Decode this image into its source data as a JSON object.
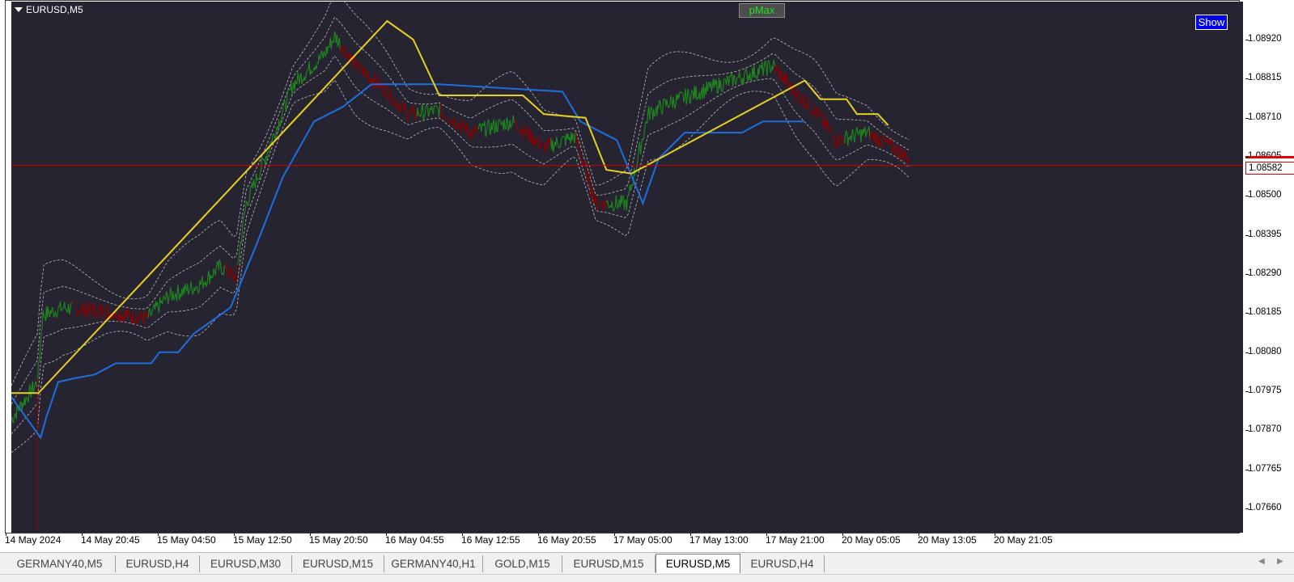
{
  "chart": {
    "symbol": "EURUSD,M5",
    "indicator_label": "pMax",
    "show_button": "Show",
    "current_price": "1.08582",
    "price_ticks": [
      "1.08920",
      "1.08815",
      "1.08710",
      "1.08605",
      "1.08500",
      "1.08395",
      "1.08290",
      "1.08185",
      "1.08080",
      "1.07975",
      "1.07870",
      "1.07765",
      "1.07660"
    ],
    "time_ticks": [
      "14 May 2024",
      "14 May 20:45",
      "15 May 04:50",
      "15 May 12:50",
      "15 May 20:50",
      "16 May 04:55",
      "16 May 12:55",
      "16 May 20:55",
      "17 May 05:00",
      "17 May 13:00",
      "17 May 21:00",
      "20 May 05:05",
      "20 May 13:05",
      "20 May 21:05"
    ],
    "colors": {
      "background": "#272431",
      "up_candle": "#1e8a1e",
      "down_candle": "#8b0000",
      "support_line": "#1e6ee0",
      "resistance_line": "#e6d21e",
      "bands": "#d8d8d8",
      "price_line": "#d00000"
    }
  },
  "chart_data": {
    "type": "line",
    "title": "EURUSD,M5",
    "ylim": [
      1.0762,
      1.0899
    ],
    "x_start": "14 May 2024",
    "x_end": "20 May 21:05",
    "current_price": 1.08582,
    "series": [
      {
        "name": "pMax",
        "color": "#1e6ee0",
        "points": [
          [
            0.0,
            1.0796
          ],
          [
            0.028,
            1.0785
          ],
          [
            0.034,
            1.0791
          ],
          [
            0.045,
            1.08
          ],
          [
            0.061,
            1.0801
          ],
          [
            0.08,
            1.0802
          ],
          [
            0.1,
            1.0805
          ],
          [
            0.134,
            1.0805
          ],
          [
            0.142,
            1.0808
          ],
          [
            0.16,
            1.0808
          ],
          [
            0.175,
            1.0813
          ],
          [
            0.21,
            1.082
          ],
          [
            0.235,
            1.0837
          ],
          [
            0.26,
            1.0855
          ],
          [
            0.29,
            1.087
          ],
          [
            0.318,
            1.0874
          ],
          [
            0.345,
            1.088
          ],
          [
            0.41,
            1.088
          ],
          [
            0.528,
            1.0878
          ],
          [
            0.545,
            1.087
          ],
          [
            0.58,
            1.0865
          ],
          [
            0.605,
            1.0848
          ],
          [
            0.62,
            1.086
          ],
          [
            0.645,
            1.0867
          ],
          [
            0.7,
            1.0867
          ],
          [
            0.72,
            1.087
          ],
          [
            0.76,
            1.087
          ]
        ]
      },
      {
        "name": "pMax",
        "color": "#e6d21e",
        "points": [
          [
            0.0,
            1.0797
          ],
          [
            0.026,
            1.0797
          ],
          [
            0.36,
            1.0897
          ],
          [
            0.385,
            1.0892
          ],
          [
            0.41,
            1.0877
          ],
          [
            0.49,
            1.0877
          ],
          [
            0.51,
            1.0872
          ],
          [
            0.55,
            1.0871
          ],
          [
            0.57,
            1.0857
          ],
          [
            0.594,
            1.0856
          ],
          [
            0.76,
            1.0881
          ],
          [
            0.775,
            1.0876
          ],
          [
            0.8,
            1.0876
          ],
          [
            0.81,
            1.0872
          ],
          [
            0.83,
            1.0872
          ],
          [
            0.84,
            1.0869
          ]
        ]
      }
    ]
  },
  "tabs": [
    {
      "label": "GERMANY40,M5",
      "active": false
    },
    {
      "label": "EURUSD,H4",
      "active": false
    },
    {
      "label": "EURUSD,M30",
      "active": false
    },
    {
      "label": "EURUSD,M15",
      "active": false
    },
    {
      "label": "GERMANY40,H1",
      "active": false
    },
    {
      "label": "GOLD,M15",
      "active": false
    },
    {
      "label": "EURUSD,M15",
      "active": false
    },
    {
      "label": "EURUSD,M5",
      "active": true
    },
    {
      "label": "EURUSD,H4",
      "active": false
    }
  ],
  "tab_nav": {
    "prev": "◀",
    "next": "▶"
  }
}
